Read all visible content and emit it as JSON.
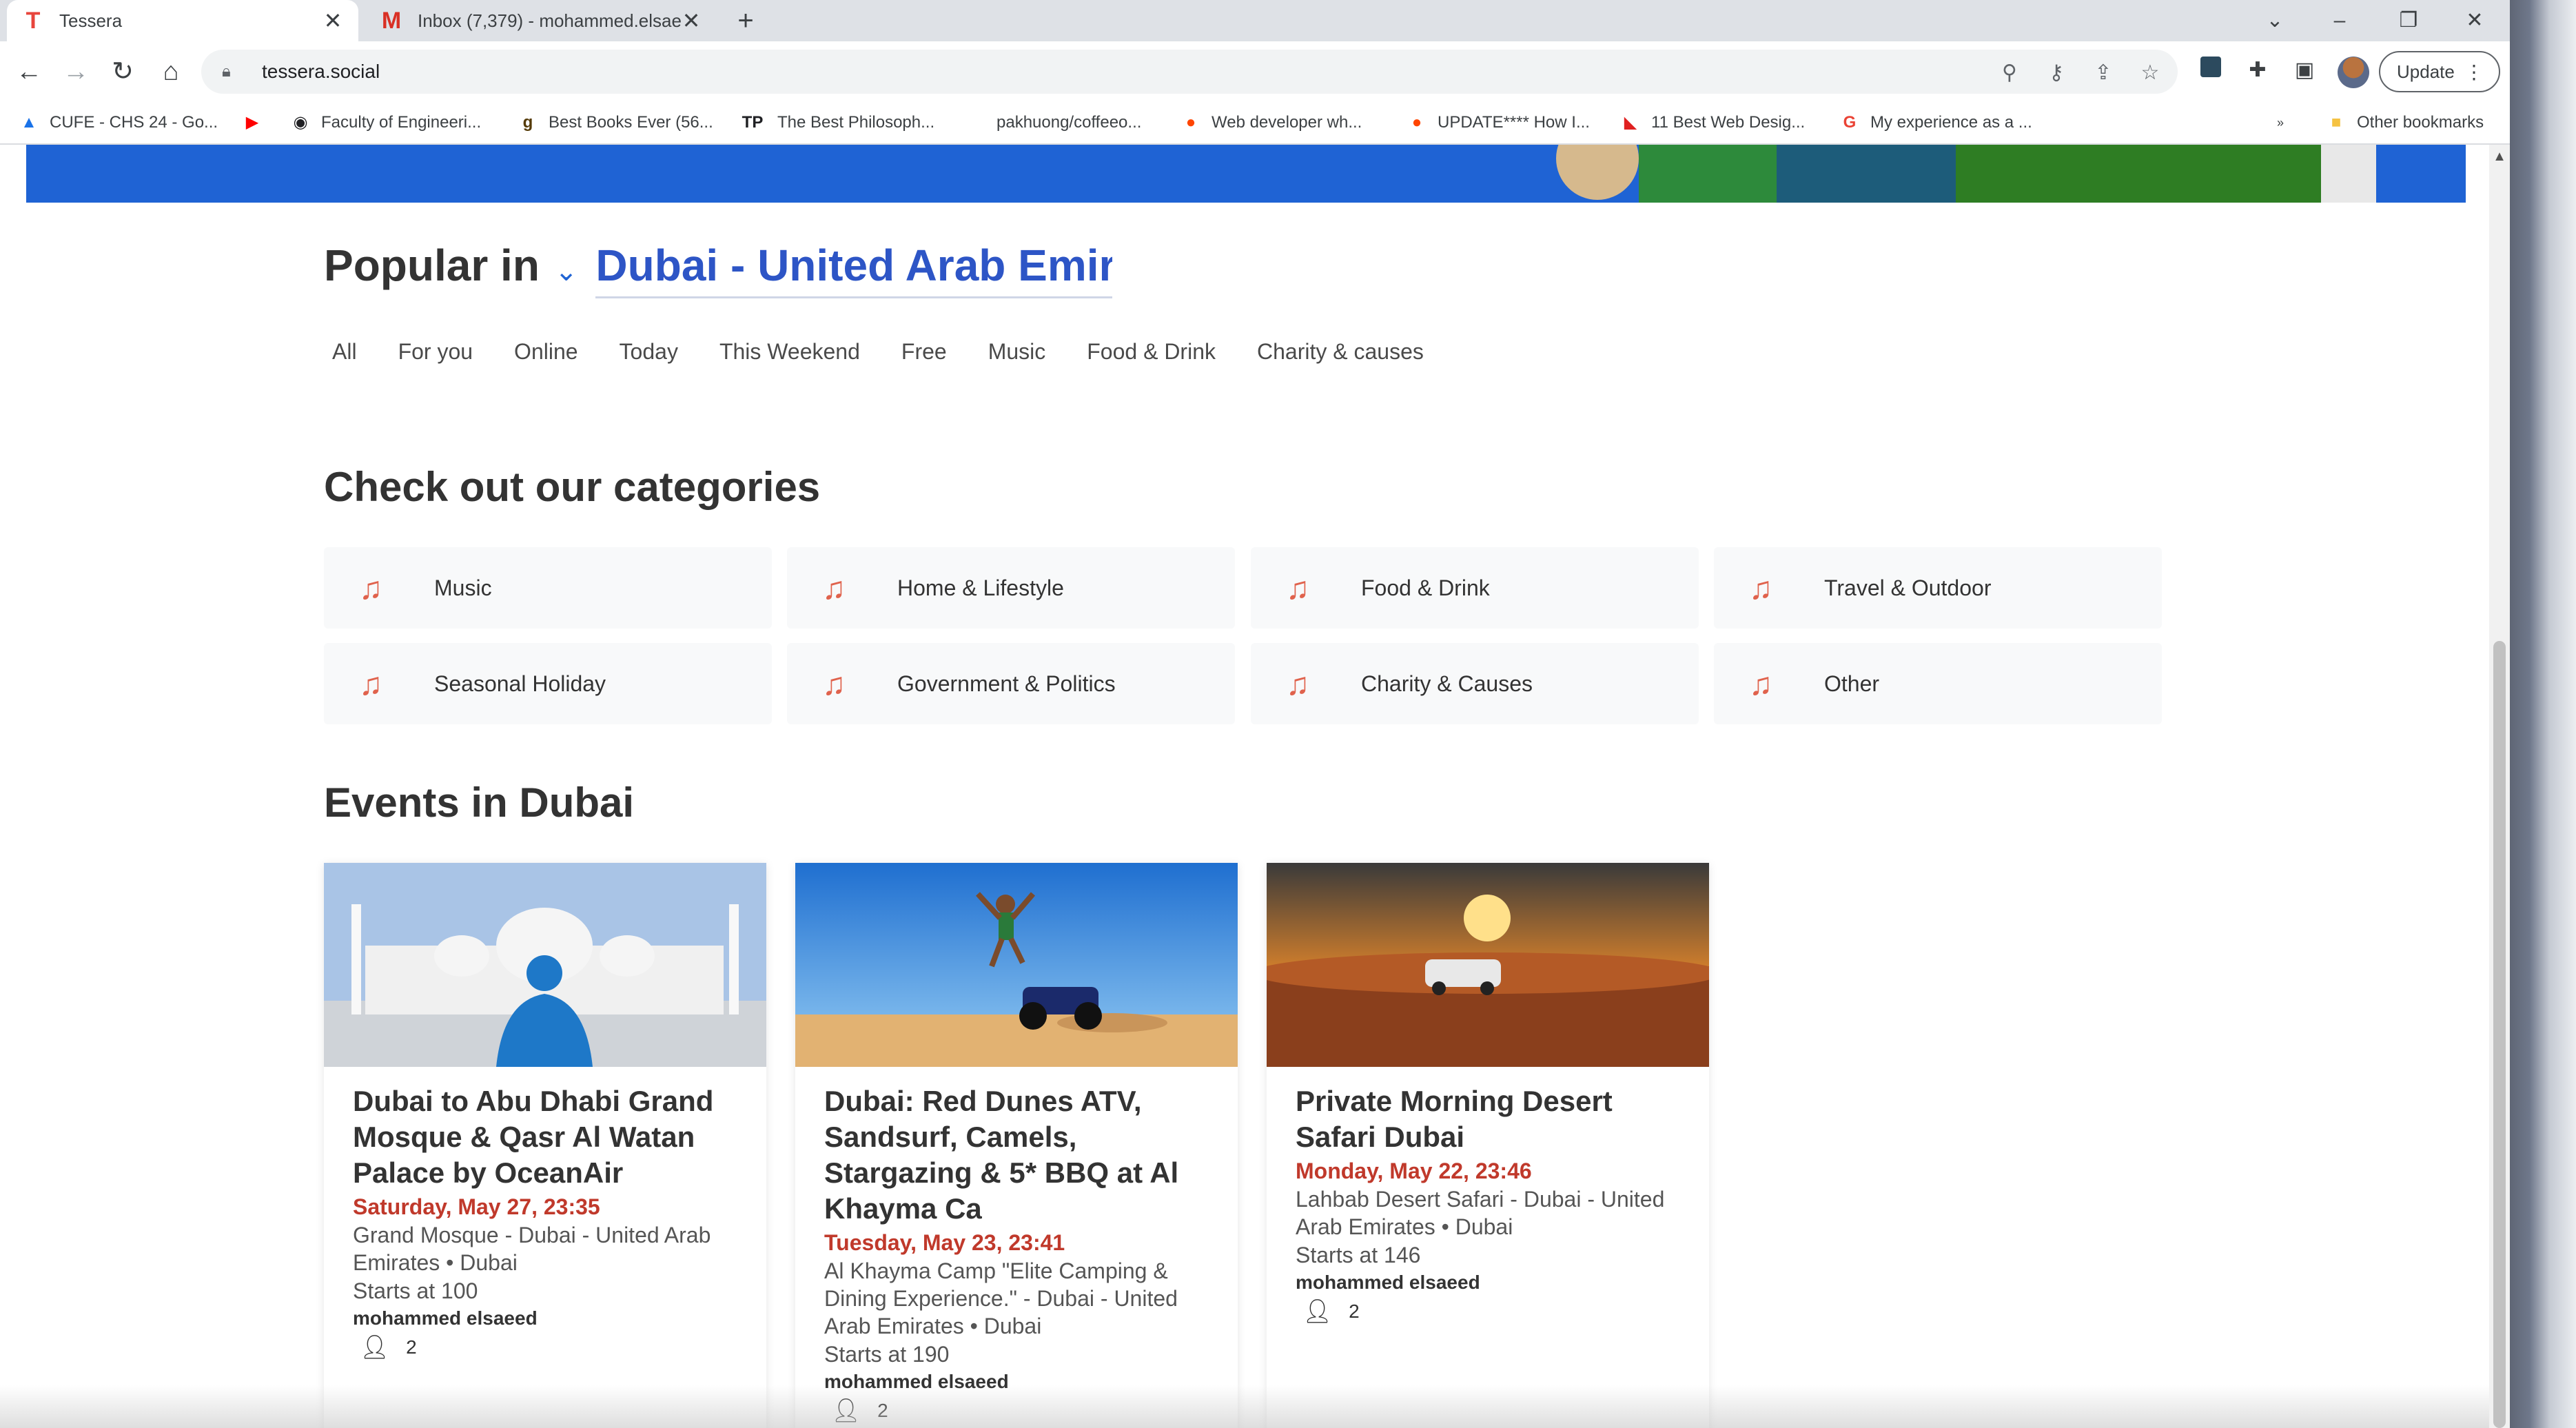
{
  "browser": {
    "tabs": [
      {
        "title": "Tessera",
        "icon": "T",
        "icon_color": "#e8453c"
      },
      {
        "title": "Inbox (7,379) - mohammed.elsae",
        "icon": "M",
        "icon_color": "#d93025"
      }
    ],
    "url": "tessera.social",
    "update_label": "Update",
    "bookmarks": [
      {
        "label": "CUFE - CHS 24 - Go...",
        "icon": "drive-icon"
      },
      {
        "label": "",
        "icon": "youtube-icon"
      },
      {
        "label": "Faculty of Engineeri...",
        "icon": "github-icon"
      },
      {
        "label": "Best Books Ever (56...",
        "icon": "goodreads-icon"
      },
      {
        "label": "The Best Philosoph...",
        "icon": "tp-icon"
      },
      {
        "label": "pakhuong/coffeeo...",
        "icon": ""
      },
      {
        "label": "Web developer wh...",
        "icon": "reddit-icon"
      },
      {
        "label": "UPDATE**** How I...",
        "icon": "reddit-icon"
      },
      {
        "label": "11 Best Web Desig...",
        "icon": "bookmark-icon"
      },
      {
        "label": "My experience as a ...",
        "icon": "google-icon"
      }
    ],
    "other_bookmarks": "Other bookmarks"
  },
  "popular": {
    "label": "Popular in",
    "city": "Dubai - United Arab Emirates",
    "filters": [
      "All",
      "For you",
      "Online",
      "Today",
      "This Weekend",
      "Free",
      "Music",
      "Food & Drink",
      "Charity & causes"
    ]
  },
  "categories": {
    "title": "Check out our categories",
    "items": [
      "Music",
      "Home & Lifestyle",
      "Food & Drink",
      "Travel & Outdoor",
      "Seasonal Holiday",
      "Government & Politics",
      "Charity & Causes",
      "Other"
    ]
  },
  "events": {
    "title": "Events in Dubai",
    "cards": [
      {
        "title": "Dubai to Abu Dhabi Grand Mosque & Qasr Al Watan Palace by OceanAir",
        "date": "Saturday, May 27, 23:35",
        "location": "Grand Mosque - Dubai - United Arab Emirates • Dubai",
        "price": "Starts at 100",
        "organizer": "mohammed elsaeed",
        "attendees": "2"
      },
      {
        "title": "Dubai: Red Dunes ATV, Sandsurf, Camels, Stargazing & 5* BBQ at Al Khayma Ca",
        "date": "Tuesday, May 23, 23:41",
        "location": "Al Khayma Camp \"Elite Camping & Dining Experience.\" - Dubai - United Arab Emirates • Dubai",
        "price": "Starts at 190",
        "organizer": "mohammed elsaeed",
        "attendees": "2"
      },
      {
        "title": "Private Morning Desert Safari Dubai",
        "date": "Monday, May 22, 23:46",
        "location": "Lahbab Desert Safari - Dubai - United Arab Emirates • Dubai",
        "price": "Starts at 146",
        "organizer": "mohammed elsaeed",
        "attendees": "2"
      }
    ]
  },
  "colors": {
    "accent": "#2d55c6",
    "hero": "#1f63d4",
    "date": "#c0392b",
    "category_icon": "#e0624c"
  }
}
